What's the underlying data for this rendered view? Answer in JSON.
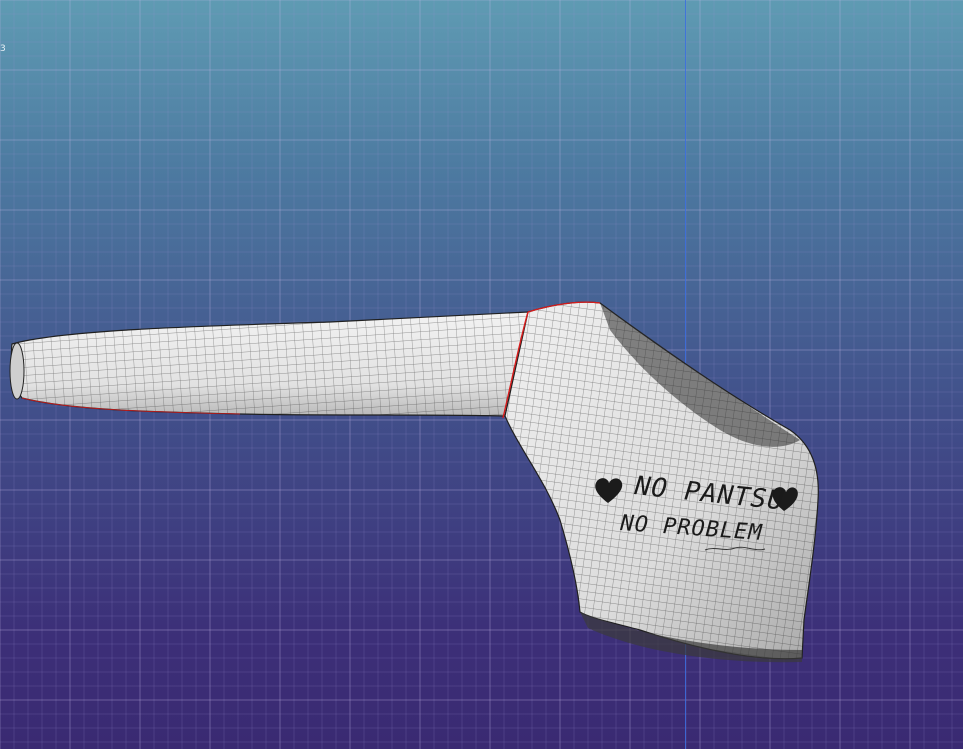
{
  "viewport": {
    "corner_label": "3",
    "background_top": "#5f9bb3",
    "background_bottom": "#3a2a72",
    "axis_color": "#3b6fe0",
    "seam_color": "#d81c1c"
  },
  "garment": {
    "print_line_1": "NO PANTSU",
    "print_line_2": "NO PROBLEM",
    "heart_icon": "heart-icon"
  }
}
